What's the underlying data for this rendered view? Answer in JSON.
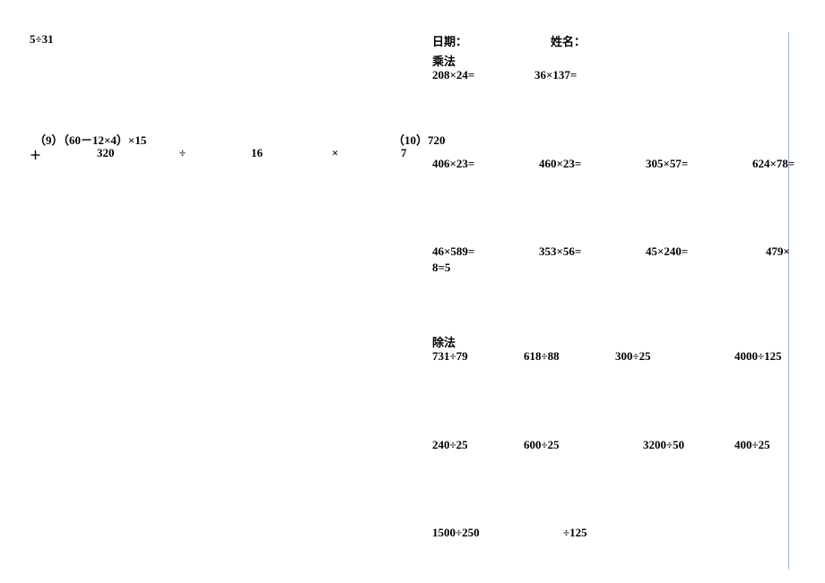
{
  "left": {
    "top": "5÷31",
    "p9": "（9）（60－12×4）×15",
    "p10": "（10）720",
    "row2_plus": "＋",
    "row2_320": "320",
    "row2_div": "÷",
    "row2_16": "16",
    "row2_times": "×",
    "row2_7": "7"
  },
  "right": {
    "date_label": "日期：",
    "name_label": "姓名：",
    "mul_heading": "乘法",
    "m1": "208×24=",
    "m2": "36×137=",
    "m3": "406×23=",
    "m4": "460×23=",
    "m5": "305×57=",
    "m6": "624×78=",
    "m7": "46×589=",
    "m8": "353×56=",
    "m9": "45×240=",
    "m10": "479×",
    "m10b": "8=5",
    "div_heading": "除法",
    "d1": "731÷79",
    "d2": "618÷88",
    "d3": "300÷25",
    "d4": "4000÷125",
    "d5": "240÷25",
    "d6": "600÷25",
    "d7": "3200÷50",
    "d8": "400÷25",
    "d9": "1500÷250",
    "d10": "÷125"
  }
}
